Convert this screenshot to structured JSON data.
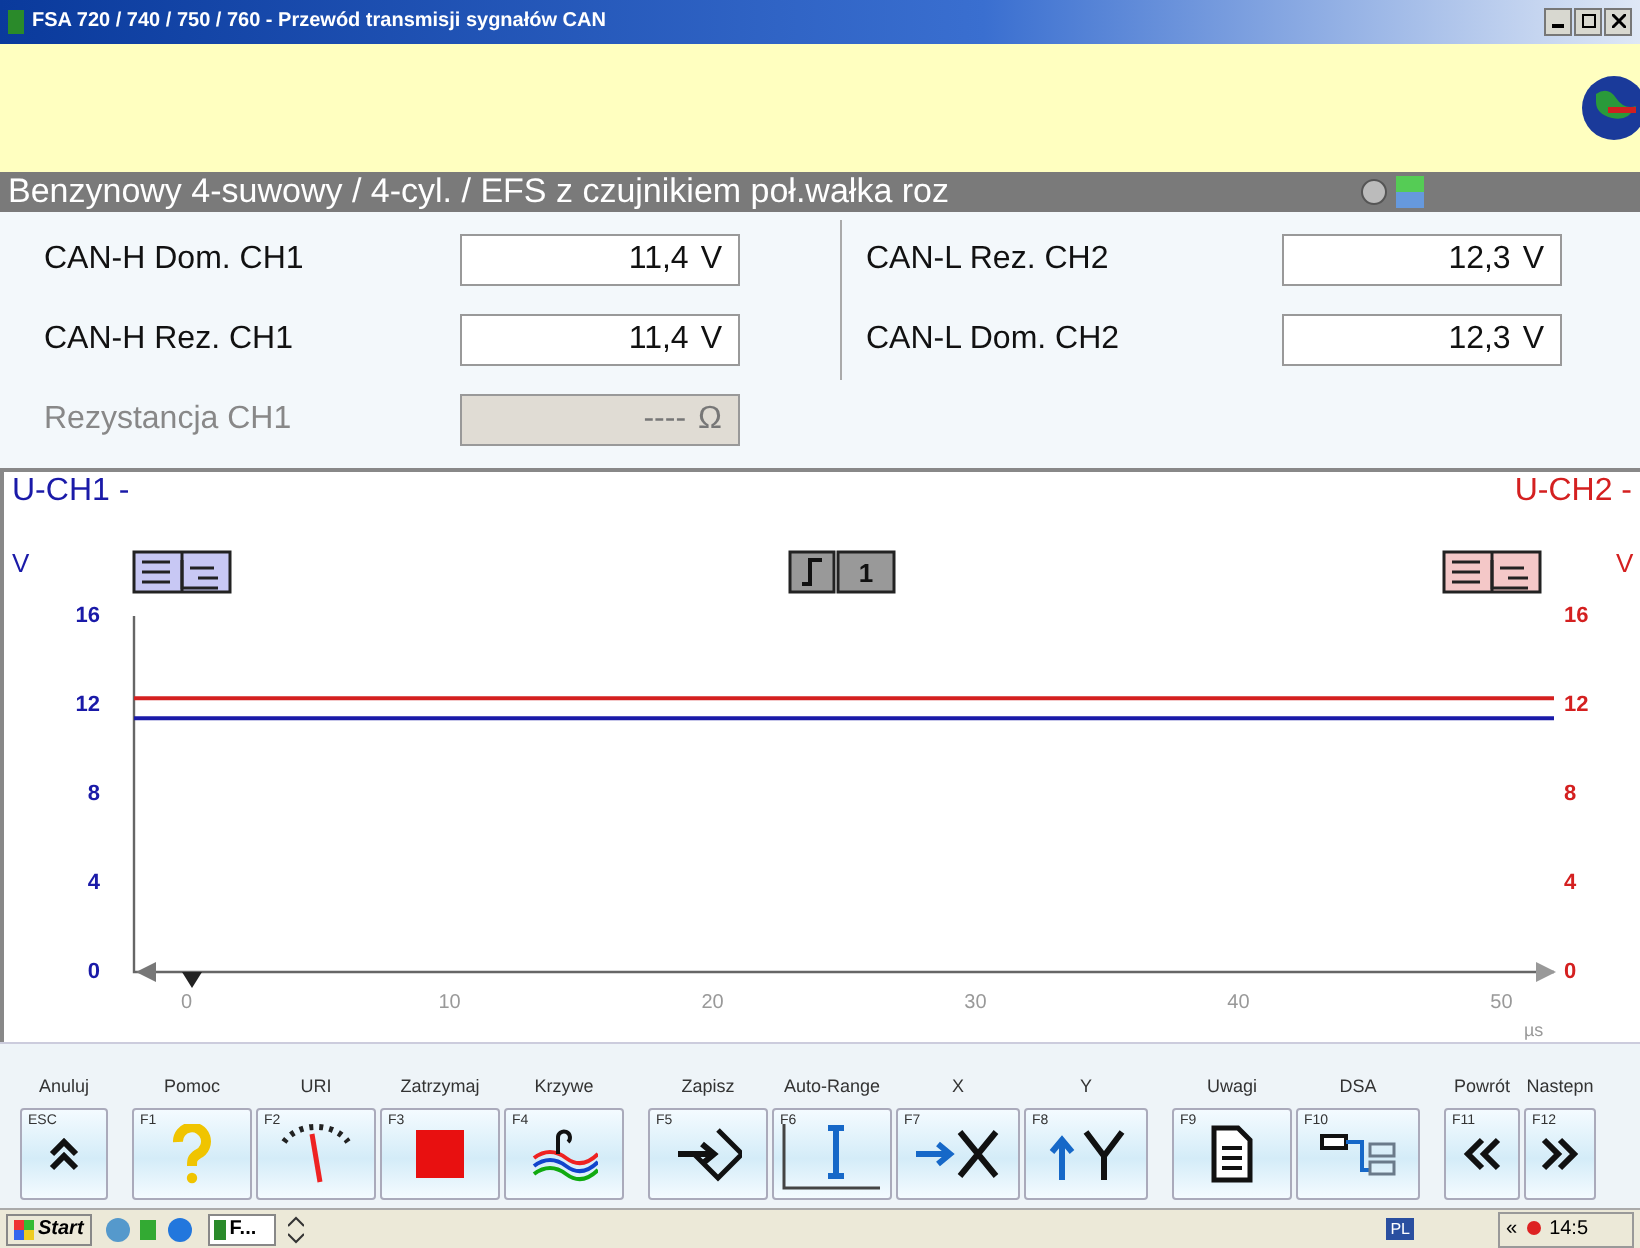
{
  "window": {
    "title": "FSA 720 / 740 / 750 / 760 - Przewód transmisji sygnałów CAN"
  },
  "header": {
    "title": "Benzynowy 4-suwowy /  4-cyl. / EFS z czujnikiem poł.wałka roz"
  },
  "measurements": [
    {
      "label": "CAN-H Dom. CH1",
      "value": "11,4",
      "unit": "V",
      "disabled": false
    },
    {
      "label": "CAN-L Rez. CH2",
      "value": "12,3",
      "unit": "V",
      "disabled": false
    },
    {
      "label": "CAN-H Rez. CH1",
      "value": "11,4",
      "unit": "V",
      "disabled": false
    },
    {
      "label": "CAN-L Dom. CH2",
      "value": "12,3",
      "unit": "V",
      "disabled": false
    },
    {
      "label": "Rezystancja CH1",
      "value": "----",
      "unit": "Ω",
      "disabled": true
    }
  ],
  "chart": {
    "trigger_channel": "1",
    "left_unit": "V",
    "right_unit": "V",
    "chart_data": {
      "type": "line",
      "xlabel": "µs",
      "x": [
        -2,
        52
      ],
      "xlim": [
        -2,
        52
      ],
      "ylim": [
        0,
        16
      ],
      "y2lim": [
        0,
        16
      ],
      "xticks": [
        0,
        10,
        20,
        30,
        40,
        50
      ],
      "yticks": [
        0,
        4,
        8,
        12,
        16
      ],
      "y2ticks": [
        0,
        4,
        8,
        12,
        16
      ],
      "series": [
        {
          "name": "U-CH1 -",
          "color": "#1a1aa8",
          "values": [
            11.4,
            11.4
          ]
        },
        {
          "name": "U-CH2 -",
          "color": "#d42020",
          "values": [
            12.3,
            12.3
          ]
        }
      ]
    }
  },
  "toolbar": [
    {
      "buttons": [
        {
          "label": "Anuluj",
          "key": "ESC",
          "kind": "up"
        }
      ]
    },
    {
      "buttons": [
        {
          "label": "Pomoc",
          "key": "F1",
          "kind": "help"
        },
        {
          "label": "URI",
          "key": "F2",
          "kind": "gauge"
        },
        {
          "label": "Zatrzymaj",
          "key": "F3",
          "kind": "stop"
        },
        {
          "label": "Krzywe",
          "key": "F4",
          "kind": "curves"
        }
      ]
    },
    {
      "buttons": [
        {
          "label": "Zapisz",
          "key": "F5",
          "kind": "save"
        },
        {
          "label": "Auto-Range",
          "key": "F6",
          "kind": "autorange"
        },
        {
          "label": "X",
          "key": "F7",
          "kind": "x"
        },
        {
          "label": "Y",
          "key": "F8",
          "kind": "y"
        }
      ]
    },
    {
      "buttons": [
        {
          "label": "Uwagi",
          "key": "F9",
          "kind": "notes"
        },
        {
          "label": "DSA",
          "key": "F10",
          "kind": "dsa"
        }
      ]
    },
    {
      "buttons": [
        {
          "label": "Powrót",
          "key": "F11",
          "kind": "back"
        },
        {
          "label": "Nastepn",
          "key": "F12",
          "kind": "next"
        }
      ]
    }
  ],
  "taskbar": {
    "start": "Start",
    "task": "F...",
    "language": "PL",
    "tray_arrow": "«",
    "clock": "14:5"
  }
}
